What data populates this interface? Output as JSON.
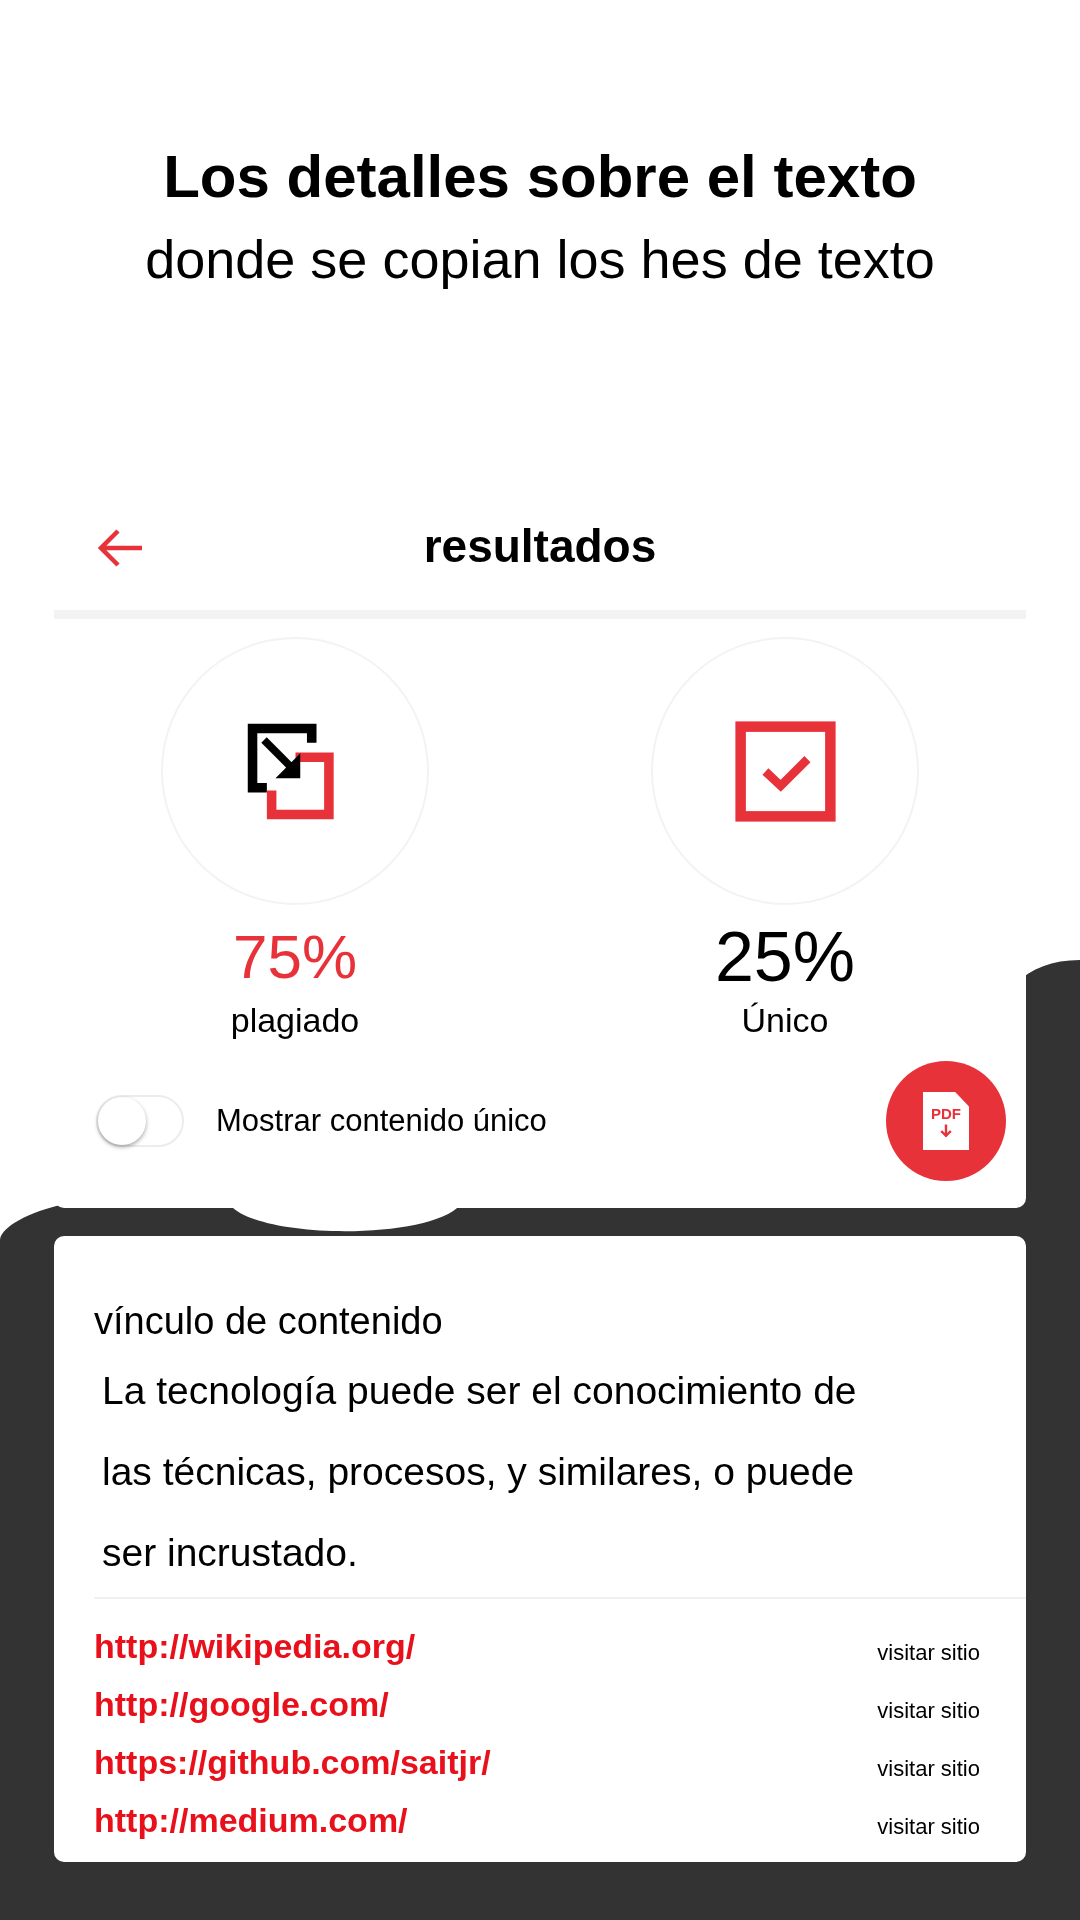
{
  "headline": "Los detalles sobre el texto",
  "subtitle": "donde se copian los hes de texto",
  "header": {
    "title": "resultados"
  },
  "stats": [
    {
      "kind": "plagiarized",
      "value": "75%",
      "label": "plagiado"
    },
    {
      "kind": "unique",
      "value": "25%",
      "label": "Único"
    }
  ],
  "toggle": {
    "label": "Mostrar contenido único",
    "on": false
  },
  "pdf_button": {
    "label": "PDF"
  },
  "content": {
    "title": "vínculo de contenido",
    "text": "La tecnología puede ser el conocimiento de las técnicas, procesos, y similares, o puede ser incrustado."
  },
  "links": [
    {
      "url": "http://wikipedia.org/",
      "action": "visitar sitio"
    },
    {
      "url": "http://google.com/",
      "action": "visitar sitio"
    },
    {
      "url": "https://github.com/saitjr/",
      "action": "visitar sitio"
    },
    {
      "url": "http://medium.com/",
      "action": "visitar sitio"
    }
  ]
}
